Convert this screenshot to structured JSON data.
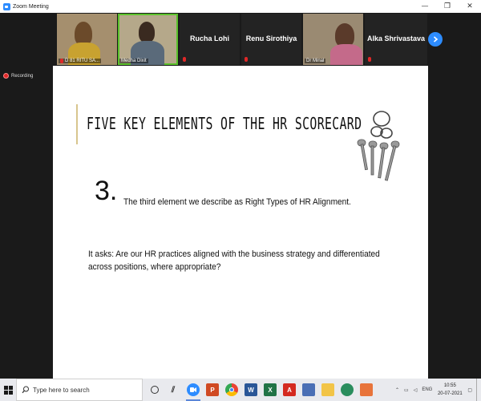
{
  "window": {
    "title": "Zoom Meeting",
    "controls": [
      "—",
      "❐",
      "✕"
    ]
  },
  "participants": [
    {
      "name": "D 81 RITU SA...",
      "type": "video"
    },
    {
      "name": "Medha Dixit",
      "type": "video",
      "active": true
    },
    {
      "name": "Rucha Lohi",
      "type": "name"
    },
    {
      "name": "Renu Sirothiya",
      "type": "name"
    },
    {
      "name": "Dr Minal",
      "type": "video"
    },
    {
      "name": "Alka Shrivastava",
      "type": "name"
    }
  ],
  "recording": {
    "label": "Recording"
  },
  "slide": {
    "title": "FIVE KEY ELEMENTS OF THE HR SCORECARD",
    "number": "3.",
    "subtitle": "The third element we describe as Right Types of HR Alignment.",
    "paragraph": "It asks: Are our HR practices aligned with the business strategy and differentiated across positions, where appropriate?"
  },
  "taskbar": {
    "search_placeholder": "Type here to search",
    "tray_lang": "ENG",
    "time": "10:55",
    "date": "20-07-2021"
  },
  "colors": {
    "zoom_blue": "#2d8cff",
    "mic_muted": "#e02828",
    "active_speaker": "#5ac12b",
    "accent_bar": "#d8c58e"
  }
}
